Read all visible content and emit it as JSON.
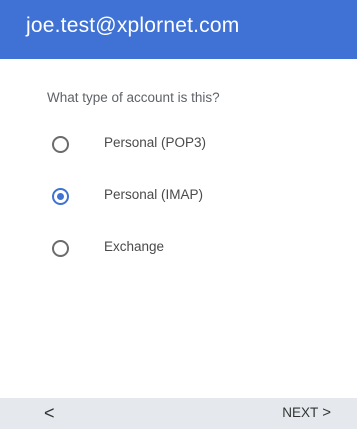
{
  "header": {
    "title": "joe.test@xplornet.com",
    "color": "#3f72d4"
  },
  "prompt": "What type of account is this?",
  "options": [
    {
      "label": "Personal (POP3)",
      "selected": false
    },
    {
      "label": "Personal (IMAP)",
      "selected": true
    },
    {
      "label": "Exchange",
      "selected": false
    }
  ],
  "footer": {
    "back_icon": "<",
    "next_label": "NEXT",
    "next_icon": ">"
  }
}
